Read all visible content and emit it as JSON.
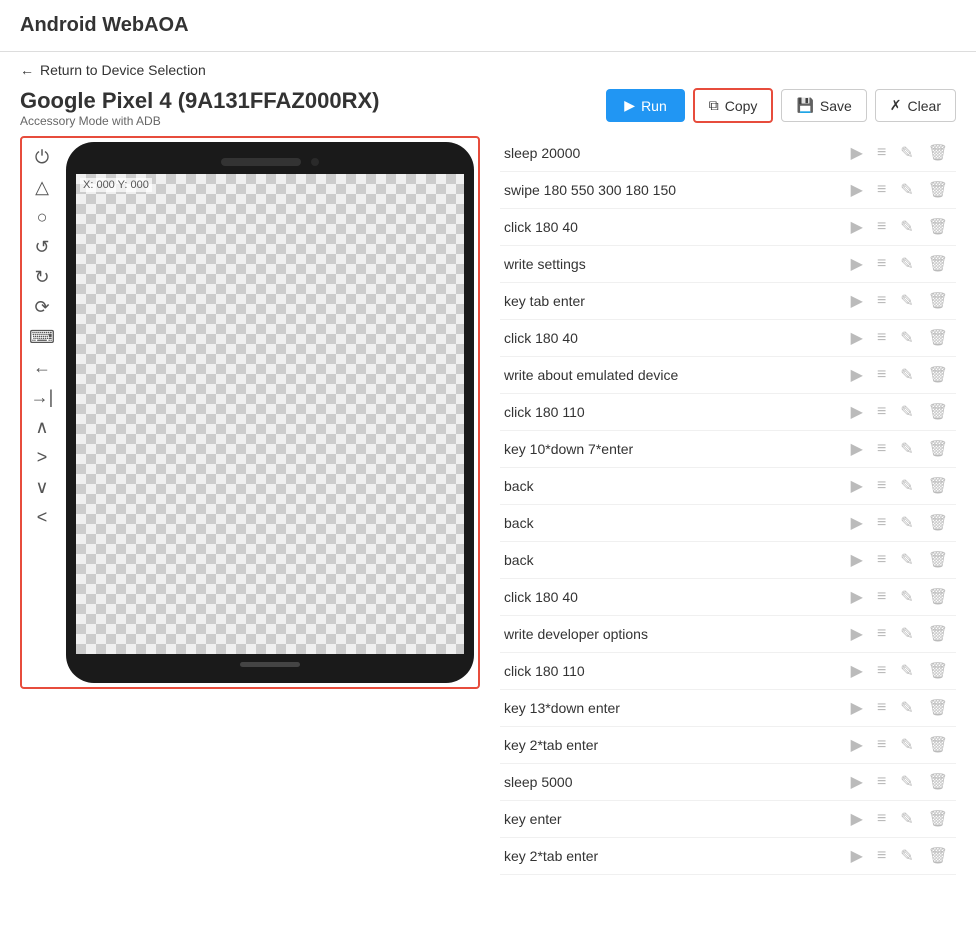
{
  "app": {
    "title": "Android WebAOA"
  },
  "nav": {
    "back_label": "Return to Device Selection"
  },
  "device": {
    "name": "Google Pixel 4 (9A131FFAZ000RX)",
    "mode": "Accessory Mode with ADB",
    "coords": "X: 000 Y: 000"
  },
  "toolbar": {
    "run_label": "Run",
    "copy_label": "Copy",
    "save_label": "Save",
    "clear_label": "Clear"
  },
  "commands": [
    {
      "id": 1,
      "text": "sleep 20000"
    },
    {
      "id": 2,
      "text": "swipe 180 550 300 180 150"
    },
    {
      "id": 3,
      "text": "click 180 40"
    },
    {
      "id": 4,
      "text": "write settings"
    },
    {
      "id": 5,
      "text": "key tab enter"
    },
    {
      "id": 6,
      "text": "click 180 40"
    },
    {
      "id": 7,
      "text": "write about emulated device"
    },
    {
      "id": 8,
      "text": "click 180 110"
    },
    {
      "id": 9,
      "text": "key 10*down 7*enter"
    },
    {
      "id": 10,
      "text": "back"
    },
    {
      "id": 11,
      "text": "back"
    },
    {
      "id": 12,
      "text": "back"
    },
    {
      "id": 13,
      "text": "click 180 40"
    },
    {
      "id": 14,
      "text": "write developer options"
    },
    {
      "id": 15,
      "text": "click 180 110"
    },
    {
      "id": 16,
      "text": "key 13*down enter"
    },
    {
      "id": 17,
      "text": "key 2*tab enter"
    },
    {
      "id": 18,
      "text": "sleep 5000"
    },
    {
      "id": 19,
      "text": "key enter"
    },
    {
      "id": 20,
      "text": "key 2*tab enter"
    }
  ],
  "controls": [
    {
      "name": "power",
      "symbol": "⏻"
    },
    {
      "name": "home",
      "symbol": "△"
    },
    {
      "name": "circle",
      "symbol": "○"
    },
    {
      "name": "rotate-left",
      "symbol": "↺"
    },
    {
      "name": "rotate-right",
      "symbol": "↻"
    },
    {
      "name": "rotate-more",
      "symbol": "⟳"
    },
    {
      "name": "keyboard",
      "symbol": "⌨"
    },
    {
      "name": "arrow-left",
      "symbol": "←"
    },
    {
      "name": "arrow-right",
      "symbol": "→|"
    },
    {
      "name": "chevron-up",
      "symbol": "∧"
    },
    {
      "name": "chevron-right",
      "symbol": ">"
    },
    {
      "name": "chevron-down",
      "symbol": "∨"
    },
    {
      "name": "chevron-left",
      "symbol": "<"
    }
  ]
}
